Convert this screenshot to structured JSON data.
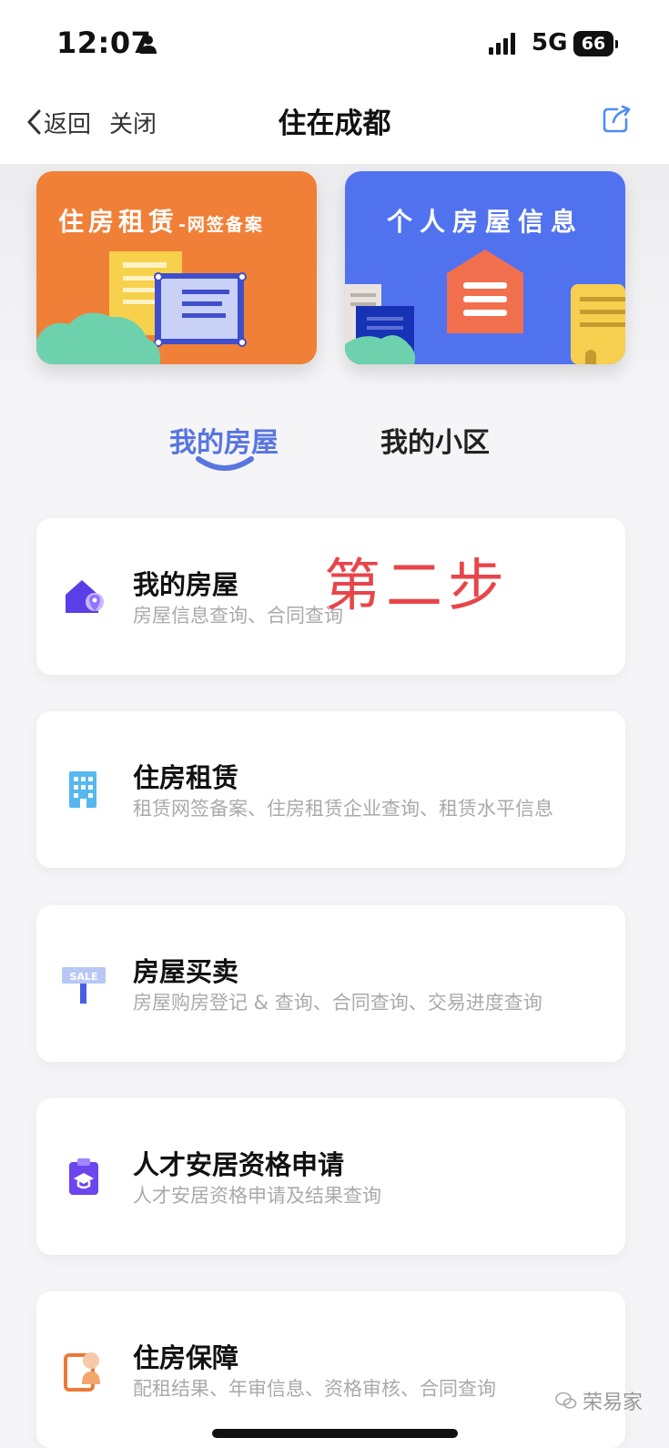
{
  "status_bar": {
    "time": "12:07",
    "network": "5G",
    "battery": "66",
    "icons": [
      "person-icon",
      "signal-icon"
    ]
  },
  "nav": {
    "back_label": "返回",
    "close_label": "关闭",
    "title": "住在成都",
    "share_icon": "share-icon"
  },
  "banners": [
    {
      "title": "住房租赁",
      "subtitle": "-网签备案",
      "color": "#f08037"
    },
    {
      "title": "个人房屋信息",
      "color": "#5172ef"
    }
  ],
  "tabs": [
    {
      "label": "我的房屋",
      "active": true
    },
    {
      "label": "我的小区",
      "active": false
    }
  ],
  "cards": [
    {
      "title": "我的房屋",
      "desc": "房屋信息查询、合同查询",
      "icon": "house-location-icon"
    },
    {
      "title": "住房租赁",
      "desc": "租赁网签备案、住房租赁企业查询、租赁水平信息",
      "icon": "building-icon"
    },
    {
      "title": "房屋买卖",
      "desc": "房屋购房登记 & 查询、合同查询、交易进度查询",
      "icon": "sale-sign-icon"
    },
    {
      "title": "人才安居资格申请",
      "desc": "人才安居资格申请及结果查询",
      "icon": "graduation-clipboard-icon"
    },
    {
      "title": "住房保障",
      "desc": "配租结果、年审信息、资格审核、合同查询",
      "icon": "housing-security-icon"
    }
  ],
  "annotation": "第二步",
  "sale_sign_text": "SALE",
  "watermark": "荣易家",
  "colors": {
    "accent": "#5875e0",
    "annotation": "#e8454a",
    "orange": "#f08037",
    "blue": "#5172ef"
  }
}
